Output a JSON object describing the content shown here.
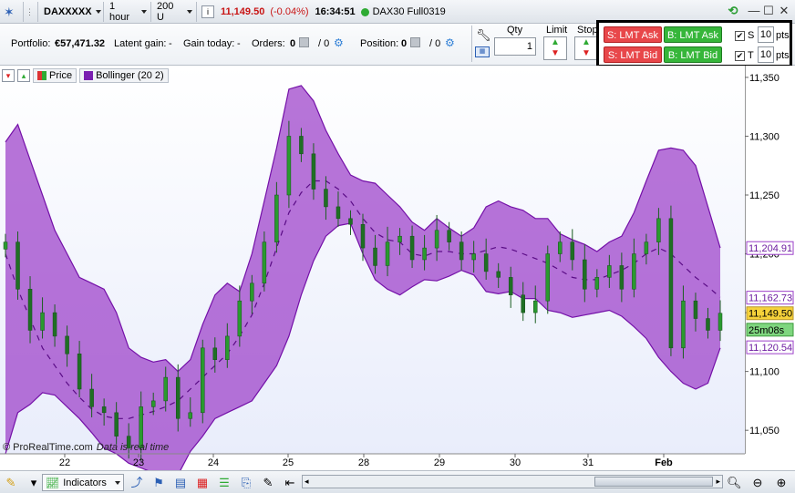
{
  "toolbar": {
    "instrument": "DAXXXXX",
    "timeframe": "1 hour",
    "units": "200 U",
    "price": "11,149.50",
    "change": "(-0.04%)",
    "time": "16:34:51",
    "feed": "DAX30 Full0319",
    "price_color": "#c81414",
    "status_color": "#2eaa33"
  },
  "portfolio": {
    "portfolio_label": "Portfolio:",
    "portfolio_value": "€57,471.32",
    "latent_label": "Latent gain:",
    "latent_value": "-",
    "gain_label": "Gain today:",
    "gain_value": "-",
    "orders_label": "Orders:",
    "orders_value": "0",
    "orders_sep": "/ 0",
    "position_label": "Position:",
    "position_value": "0",
    "position_sep": "/ 0",
    "qty_label": "Qty",
    "qty_value": "1",
    "limit_label": "Limit",
    "stop_label": "Stop"
  },
  "order_panel": {
    "sell_ask": "S: LMT Ask",
    "buy_ask": "B: LMT Ask",
    "sell_bid": "S: LMT Bid",
    "buy_bid": "B: LMT Bid",
    "s_label": "S",
    "s_value": "10",
    "s_unit": "pts",
    "t_label": "T",
    "t_value": "10",
    "t_unit": "pts"
  },
  "legend": {
    "price_label": "Price",
    "bollinger_label": "Bollinger (20 2)",
    "band_color": "#9b3fc9"
  },
  "price_axis": {
    "ticks": [
      "11,350",
      "11,300",
      "11,250",
      "11,200",
      "11,150",
      "11,100",
      "11,050"
    ],
    "upper_label": "11,204.91",
    "mid_label": "11,162.73",
    "last_label": "11,149.50",
    "timer_label": "25m08s",
    "lower_label": "11,120.54"
  },
  "time_axis": {
    "labels": [
      "22",
      "23",
      "24",
      "25",
      "28",
      "29",
      "30",
      "31",
      "Feb"
    ]
  },
  "watermark": {
    "brand": "© ProRealTime.com",
    "note": "Data is real time"
  },
  "bottombar": {
    "indicators_label": "Indicators"
  },
  "chart_data": {
    "type": "candlestick",
    "ylim": [
      11030,
      11360
    ],
    "ticks": [
      11350,
      11300,
      11250,
      11200,
      11150,
      11100,
      11050
    ],
    "x_labels": [
      "22",
      "23",
      "24",
      "25",
      "28",
      "29",
      "30",
      "31",
      "Feb"
    ],
    "bollinger_upper": [
      11295,
      11310,
      11280,
      11250,
      11220,
      11200,
      11180,
      11175,
      11170,
      11150,
      11120,
      11112,
      11108,
      11110,
      11100,
      11110,
      11140,
      11165,
      11175,
      11168,
      11200,
      11245,
      11290,
      11340,
      11343,
      11330,
      11305,
      11285,
      11267,
      11262,
      11260,
      11250,
      11240,
      11227,
      11220,
      11230,
      11222,
      11215,
      11222,
      11240,
      11245,
      11240,
      11237,
      11230,
      11230,
      11217,
      11212,
      11208,
      11202,
      11210,
      11215,
      11235,
      11262,
      11288,
      11290,
      11288,
      11275,
      11240,
      11205
    ],
    "bollinger_mid": [
      11200,
      11170,
      11145,
      11120,
      11105,
      11090,
      11078,
      11068,
      11062,
      11060,
      11060,
      11063,
      11066,
      11070,
      11075,
      11085,
      11095,
      11105,
      11115,
      11130,
      11148,
      11175,
      11205,
      11235,
      11252,
      11262,
      11262,
      11255,
      11245,
      11230,
      11218,
      11212,
      11210,
      11200,
      11198,
      11202,
      11202,
      11200,
      11200,
      11203,
      11206,
      11204,
      11200,
      11196,
      11192,
      11186,
      11180,
      11178,
      11178,
      11182,
      11186,
      11192,
      11200,
      11205,
      11200,
      11190,
      11180,
      11172,
      11163
    ],
    "bollinger_lower": [
      11030,
      11065,
      11072,
      11082,
      11080,
      11070,
      11060,
      11048,
      11035,
      11030,
      11022,
      11018,
      11014,
      11010,
      11012,
      11032,
      11045,
      11060,
      11065,
      11070,
      11075,
      11090,
      11105,
      11130,
      11165,
      11194,
      11215,
      11224,
      11226,
      11200,
      11178,
      11170,
      11165,
      11172,
      11178,
      11177,
      11181,
      11186,
      11182,
      11168,
      11166,
      11168,
      11162,
      11162,
      11152,
      11150,
      11146,
      11148,
      11150,
      11152,
      11147,
      11138,
      11128,
      11112,
      11100,
      11090,
      11085,
      11090,
      11120
    ],
    "close": [
      11210,
      11170,
      11135,
      11150,
      11130,
      11115,
      11085,
      11070,
      11065,
      11045,
      11035,
      11070,
      11075,
      11095,
      11060,
      11065,
      11120,
      11110,
      11130,
      11160,
      11175,
      11210,
      11250,
      11300,
      11285,
      11255,
      11240,
      11230,
      11225,
      11205,
      11190,
      11210,
      11215,
      11195,
      11205,
      11220,
      11210,
      11195,
      11200,
      11185,
      11180,
      11165,
      11150,
      11160,
      11200,
      11210,
      11195,
      11170,
      11180,
      11190,
      11170,
      11200,
      11210,
      11230,
      11120,
      11160,
      11145,
      11135,
      11149.5
    ]
  }
}
